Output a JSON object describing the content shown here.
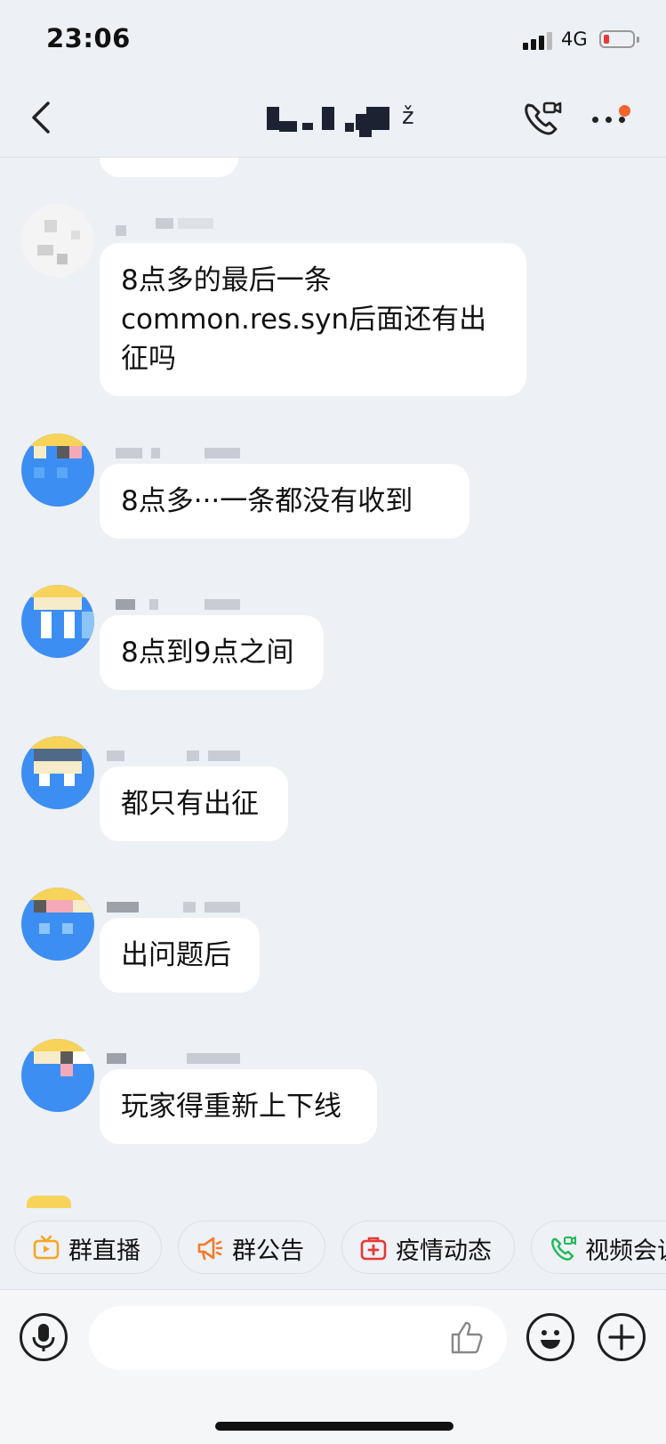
{
  "status_bar": {
    "time": "23:06",
    "network": "4G"
  },
  "header": {
    "title": "[pixelated group name]"
  },
  "messages": [
    {
      "text": "8点多的最后一条\ncommon.res.syn后面还有出\n征吗"
    },
    {
      "text": "8点多···一条都没有收到"
    },
    {
      "text": "8点到9点之间"
    },
    {
      "text": "都只有出征"
    },
    {
      "text": "出问题后"
    },
    {
      "text": "玩家得重新上下线"
    }
  ],
  "quick_actions": [
    {
      "label": "群直播",
      "icon": "tv-icon",
      "color": "#f5a623"
    },
    {
      "label": "群公告",
      "icon": "megaphone-icon",
      "color": "#f47b2a"
    },
    {
      "label": "疫情动态",
      "icon": "medical-kit-icon",
      "color": "#e53935"
    },
    {
      "label": "视频会议",
      "icon": "video-phone-icon",
      "color": "#1db954"
    }
  ],
  "input": {
    "value": "",
    "placeholder": ""
  },
  "colors": {
    "accent_red": "#f4622d",
    "bubble": "#ffffff",
    "background": "#edf0f4"
  }
}
